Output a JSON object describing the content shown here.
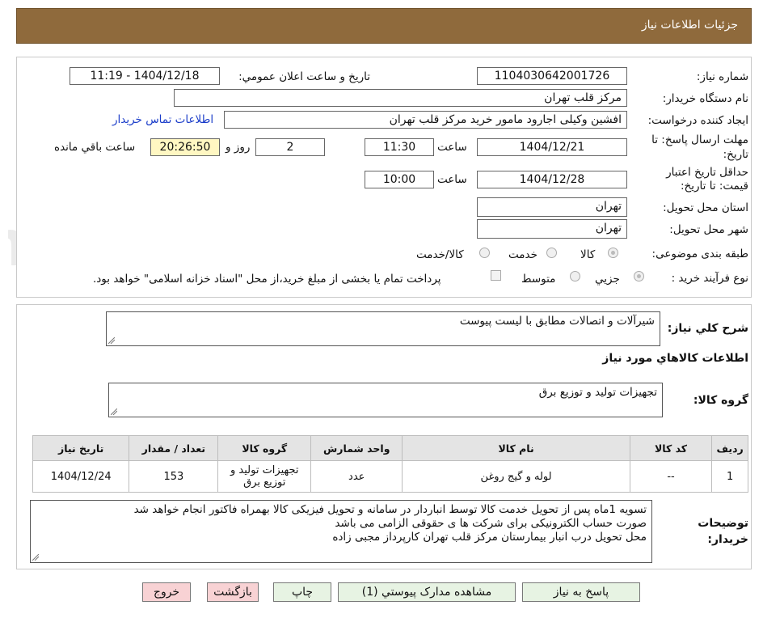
{
  "header": {
    "title": "جزئیات اطلاعات نیاز"
  },
  "info": {
    "need_number_label": "شماره نیاز:",
    "need_number": "1104030642001726",
    "announce_label": "تاریخ و ساعت اعلان عمومي:",
    "announce_value": "1404/12/18 - 11:19",
    "buyer_org_label": "نام دستگاه خریدار:",
    "buyer_org": "مرکز قلب تهران",
    "creator_label": "ایجاد کننده درخواست:",
    "creator": "افشین وکیلی اجارود مامور خرید مرکز قلب تهران",
    "contact_link": "اطلاعات تماس خریدار",
    "deadline_label": "مهلت ارسال پاسخ: تا تاریخ:",
    "deadline_date": "1404/12/21",
    "time_word": "ساعت",
    "deadline_time": "11:30",
    "days_value": "2",
    "days_word": "روز و",
    "remaining_time": "20:26:50",
    "remaining_word": "ساعت باقي مانده",
    "validity_label": "حداقل تاریخ اعتبار قیمت: تا تاریخ:",
    "validity_date": "1404/12/28",
    "validity_time": "10:00",
    "province_label": "استان محل تحویل:",
    "province": "تهران",
    "city_label": "شهر محل تحویل:",
    "city": "تهران",
    "category_label": "طبقه بندی موضوعی:",
    "category_options": [
      "کالا",
      "خدمت",
      "کالا/خدمت"
    ],
    "process_label": "نوع فرآیند خرید :",
    "process_options": [
      "جزیي",
      "متوسط"
    ],
    "payment_note": "پرداخت تمام یا بخشی از مبلغ خرید،از محل \"اسناد خزانه اسلامی\" خواهد بود."
  },
  "details": {
    "summary_label": "شرح كلي نياز:",
    "summary": "شیرآلات و اتصالات مطابق با لیست پیوست",
    "goods_info_title": "اطلاعات کالاهاي مورد نياز",
    "group_label": "گروه كالا:",
    "group_value": "تجهیزات تولید و توزیع برق",
    "table": {
      "headers": [
        "ردیف",
        "کد کالا",
        "نام کالا",
        "واحد شمارش",
        "گروه کالا",
        "تعداد / مقدار",
        "تاریخ نیاز"
      ],
      "rows": [
        [
          "1",
          "--",
          "لوله و گیج روغن",
          "عدد",
          "تجهیزات تولید و توزیع برق",
          "153",
          "1404/12/24"
        ]
      ]
    },
    "buyer_notes_label": "توضیحات خریدار:",
    "buyer_notes": [
      "تسویه 1ماه پس از تحویل خدمت کالا توسط انباردار در سامانه و تحویل فیزیکی کالا بهمراه فاکتور انجام خواهد شد",
      "صورت حساب الکترونیکی برای شرکت ها ی حقوقی الزامی می باشد",
      "محل تحویل درب انبار بیمارستان مرکز قلب تهران کارپرداز مجبی زاده"
    ]
  },
  "buttons": {
    "reply": "پاسخ به نیاز",
    "attachments": "مشاهده مدارک پیوستي (1)",
    "print": "چاپ",
    "back": "بازگشت",
    "exit": "خروج"
  },
  "watermark": "AriaTender.neT"
}
